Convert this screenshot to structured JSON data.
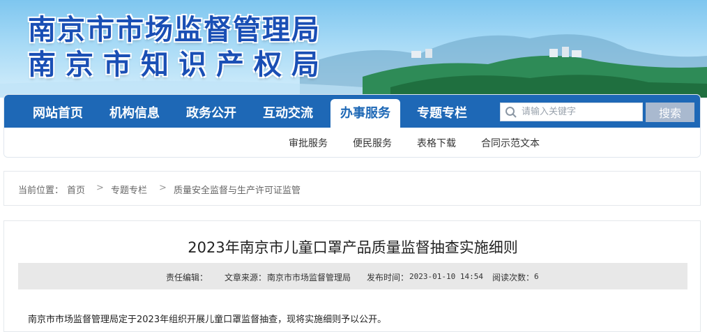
{
  "banner": {
    "title_line1": "南京市市场监督管理局",
    "title_line2": "南京市知识产权局"
  },
  "nav": {
    "items": [
      {
        "label": "网站首页"
      },
      {
        "label": "机构信息"
      },
      {
        "label": "政务公开"
      },
      {
        "label": "互动交流"
      },
      {
        "label": "办事服务",
        "active": true
      },
      {
        "label": "专题专栏"
      }
    ],
    "search_placeholder": "请输入关键字",
    "search_button": "搜索"
  },
  "subnav": {
    "items": [
      "审批服务",
      "便民服务",
      "表格下载",
      "合同示范文本"
    ]
  },
  "breadcrumb": {
    "prefix": "当前位置：",
    "items": [
      "首页",
      "专题专栏",
      "质量安全监督与生产许可证监管"
    ],
    "separator": ">"
  },
  "article": {
    "title": "2023年南京市儿童口罩产品质量监督抽查实施细则",
    "meta": {
      "editor_label": "责任编辑：",
      "source_label": "文章来源：",
      "source_value": "南京市市场监督管理局",
      "published_label": "发布时间：",
      "published_value": "2023-01-10 14:54",
      "reads_label": "阅读次数：",
      "reads_value": "6"
    },
    "body": "南京市市场监督管理局定于2023年组织开展儿童口罩监督抽查，现将实施细则予以公开。"
  },
  "colors": {
    "nav_blue": "#1e68b6",
    "title_blue": "#1a4fb5",
    "search_button": "#a9b9cf"
  }
}
